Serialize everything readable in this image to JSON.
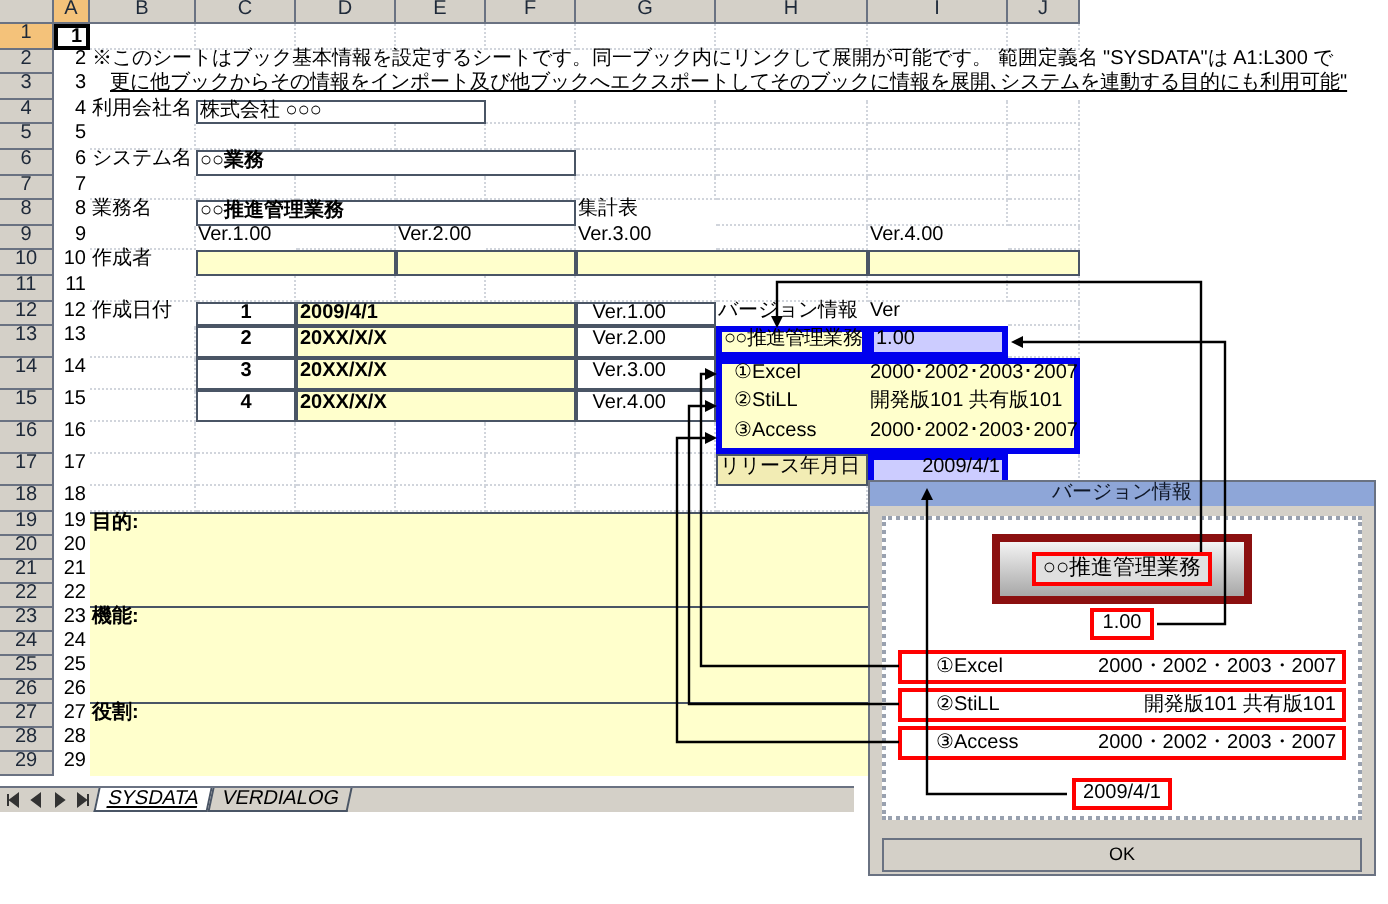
{
  "column_headers": [
    {
      "label": "A",
      "selected": true
    },
    {
      "label": "B",
      "selected": false
    },
    {
      "label": "C",
      "selected": false
    },
    {
      "label": "D",
      "selected": false
    },
    {
      "label": "E",
      "selected": false
    },
    {
      "label": "F",
      "selected": false
    },
    {
      "label": "G",
      "selected": false
    },
    {
      "label": "H",
      "selected": false
    },
    {
      "label": "I",
      "selected": false
    },
    {
      "label": "J",
      "selected": false
    }
  ],
  "rows": [
    {
      "header": "1",
      "selected": true,
      "cells": {
        "A": "1"
      }
    },
    {
      "header": "2",
      "selected": false,
      "cells": {
        "A": "2",
        "B": "※このシートはブック基本情報を設定するシートです。同一ブック内にリンクして展開が可能です。 範囲定義名 \"SYSDATA\"は A1:L300 で"
      }
    },
    {
      "header": "3",
      "selected": false,
      "cells": {
        "A": "3",
        "B": "更に他ブックからその情報をインポート及び他ブックへエクスポートしてそのブックに情報を展開､システムを連動する目的にも利用可能\""
      }
    },
    {
      "header": "4",
      "selected": false,
      "cells": {
        "A": "4",
        "B": "利用会社名",
        "C": "株式会社 ○○○"
      }
    },
    {
      "header": "5",
      "selected": false,
      "cells": {
        "A": "5"
      }
    },
    {
      "header": "6",
      "selected": false,
      "cells": {
        "A": "6",
        "B": "システム名",
        "C": "○○業務"
      }
    },
    {
      "header": "7",
      "selected": false,
      "cells": {
        "A": "7"
      }
    },
    {
      "header": "8",
      "selected": false,
      "cells": {
        "A": "8",
        "B": "業務名",
        "C": "○○推進管理業務",
        "G": "集計表"
      }
    },
    {
      "header": "9",
      "selected": false,
      "cells": {
        "A": "9",
        "C": "Ver.1.00",
        "E": "Ver.2.00",
        "G": "Ver.3.00",
        "I": "Ver.4.00"
      }
    },
    {
      "header": "10",
      "selected": false,
      "cells": {
        "A": "10",
        "B": "作成者"
      }
    },
    {
      "header": "11",
      "selected": false,
      "cells": {
        "A": "11"
      }
    },
    {
      "header": "12",
      "selected": false,
      "cells": {
        "A": "12",
        "B": "作成日付",
        "C": "1",
        "D": "2009/4/1",
        "G": "Ver.1.00",
        "H": "バージョン情報",
        "I": "Ver"
      }
    },
    {
      "header": "13",
      "selected": false,
      "cells": {
        "A": "13",
        "C": "2",
        "D": "20XX/X/X",
        "G": "Ver.2.00",
        "H": "○○推進管理業務",
        "I": "1.00"
      }
    },
    {
      "header": "14",
      "selected": false,
      "cells": {
        "A": "14",
        "C": "3",
        "D": "20XX/X/X",
        "G": "Ver.3.00",
        "H": "①Excel",
        "I": "2000･2002･2003･2007"
      }
    },
    {
      "header": "15",
      "selected": false,
      "cells": {
        "A": "15",
        "C": "4",
        "D": "20XX/X/X",
        "G": "Ver.4.00",
        "H": "②StiLL",
        "I": "開発版101 共有版101"
      }
    },
    {
      "header": "16",
      "selected": false,
      "cells": {
        "A": "16",
        "H": "③Access",
        "I": "2000･2002･2003･2007"
      }
    },
    {
      "header": "17",
      "selected": false,
      "cells": {
        "A": "17",
        "H": "リリース年月日",
        "I": "2009/4/1"
      }
    },
    {
      "header": "18",
      "selected": false,
      "cells": {
        "A": "18"
      }
    },
    {
      "header": "19",
      "selected": false,
      "cells": {
        "A": "19",
        "B": "目的:"
      }
    },
    {
      "header": "20",
      "selected": false,
      "cells": {
        "A": "20"
      }
    },
    {
      "header": "21",
      "selected": false,
      "cells": {
        "A": "21"
      }
    },
    {
      "header": "22",
      "selected": false,
      "cells": {
        "A": "22"
      }
    },
    {
      "header": "23",
      "selected": false,
      "cells": {
        "A": "23",
        "B": "機能:"
      }
    },
    {
      "header": "24",
      "selected": false,
      "cells": {
        "A": "24"
      }
    },
    {
      "header": "25",
      "selected": false,
      "cells": {
        "A": "25"
      }
    },
    {
      "header": "26",
      "selected": false,
      "cells": {
        "A": "26"
      }
    },
    {
      "header": "27",
      "selected": false,
      "cells": {
        "A": "27",
        "B": "役割:"
      }
    },
    {
      "header": "28",
      "selected": false,
      "cells": {
        "A": "28"
      }
    },
    {
      "header": "29",
      "selected": false,
      "cells": {
        "A": "29"
      }
    }
  ],
  "sheet_tabs": [
    {
      "label": "SYSDATA",
      "selected": true
    },
    {
      "label": "VERDIALOG",
      "selected": false
    }
  ],
  "dialog": {
    "title": "バージョン情報",
    "app_name": "○○推進管理業務",
    "version": "1.00",
    "products": [
      {
        "name": "①Excel",
        "versions": "2000・2002・2003・2007"
      },
      {
        "name": "②StiLL",
        "versions": "開発版101 共有版101"
      },
      {
        "name": "③Access",
        "versions": "2000・2002・2003・2007"
      }
    ],
    "release_date": "2009/4/1",
    "ok_button": "OK"
  }
}
